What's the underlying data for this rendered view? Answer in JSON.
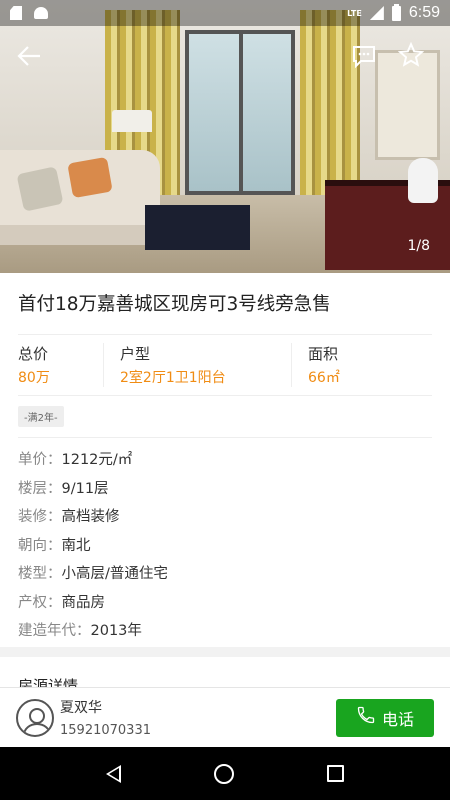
{
  "status_bar": {
    "time": "6:59",
    "network": "LTE"
  },
  "gallery": {
    "counter": "1/8"
  },
  "listing": {
    "title": "首付18万嘉善城区现房可3号线旁急售",
    "summary": [
      {
        "label": "总价",
        "value": "80万"
      },
      {
        "label": "户型",
        "value": "2室2厅1卫1阳台"
      },
      {
        "label": "面积",
        "value": "66㎡"
      }
    ],
    "tag": "-满2年-",
    "details": [
      {
        "key": "单价：",
        "value": "1212元/㎡"
      },
      {
        "key": "楼层：",
        "value": "9/11层"
      },
      {
        "key": "装修：",
        "value": "高档装修"
      },
      {
        "key": "朝向：",
        "value": "南北"
      },
      {
        "key": "楼型：",
        "value": "小高层/普通住宅"
      },
      {
        "key": "产权：",
        "value": "商品房"
      },
      {
        "key": "建造年代：",
        "value": "2013年"
      }
    ]
  },
  "section": {
    "title": "房源详情"
  },
  "contact": {
    "name": "夏双华",
    "phone": "15921070331",
    "call_label": "电话"
  },
  "colors": {
    "accent": "#f08c14",
    "call": "#19a51f"
  },
  "icons": {
    "back": "arrow-left-icon",
    "chat": "chat-bubble-icon",
    "favorite": "star-outline-icon",
    "call": "phone-icon"
  }
}
